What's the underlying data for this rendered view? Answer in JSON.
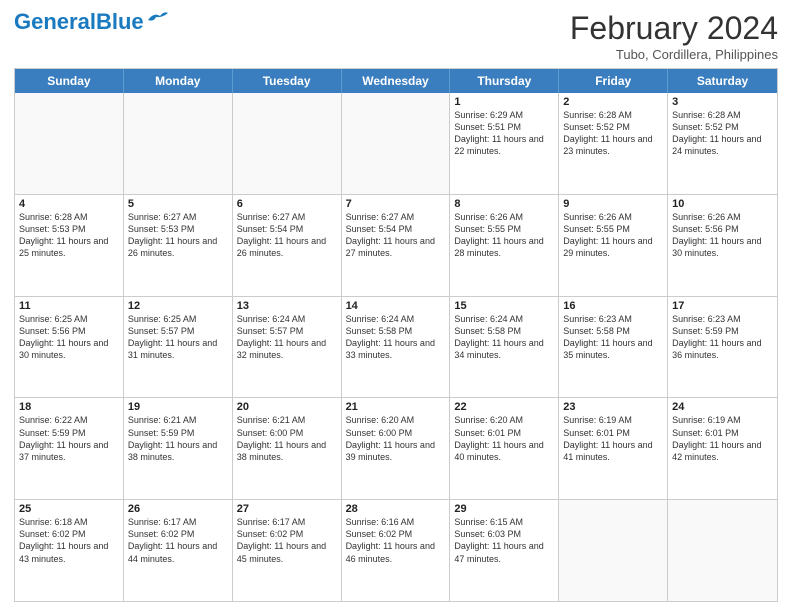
{
  "header": {
    "logo_line1": "General",
    "logo_line2": "Blue",
    "month_year": "February 2024",
    "location": "Tubo, Cordillera, Philippines"
  },
  "weekdays": [
    "Sunday",
    "Monday",
    "Tuesday",
    "Wednesday",
    "Thursday",
    "Friday",
    "Saturday"
  ],
  "weeks": [
    [
      {
        "day": "",
        "info": ""
      },
      {
        "day": "",
        "info": ""
      },
      {
        "day": "",
        "info": ""
      },
      {
        "day": "",
        "info": ""
      },
      {
        "day": "1",
        "info": "Sunrise: 6:29 AM\nSunset: 5:51 PM\nDaylight: 11 hours\nand 22 minutes."
      },
      {
        "day": "2",
        "info": "Sunrise: 6:28 AM\nSunset: 5:52 PM\nDaylight: 11 hours\nand 23 minutes."
      },
      {
        "day": "3",
        "info": "Sunrise: 6:28 AM\nSunset: 5:52 PM\nDaylight: 11 hours\nand 24 minutes."
      }
    ],
    [
      {
        "day": "4",
        "info": "Sunrise: 6:28 AM\nSunset: 5:53 PM\nDaylight: 11 hours\nand 25 minutes."
      },
      {
        "day": "5",
        "info": "Sunrise: 6:27 AM\nSunset: 5:53 PM\nDaylight: 11 hours\nand 26 minutes."
      },
      {
        "day": "6",
        "info": "Sunrise: 6:27 AM\nSunset: 5:54 PM\nDaylight: 11 hours\nand 26 minutes."
      },
      {
        "day": "7",
        "info": "Sunrise: 6:27 AM\nSunset: 5:54 PM\nDaylight: 11 hours\nand 27 minutes."
      },
      {
        "day": "8",
        "info": "Sunrise: 6:26 AM\nSunset: 5:55 PM\nDaylight: 11 hours\nand 28 minutes."
      },
      {
        "day": "9",
        "info": "Sunrise: 6:26 AM\nSunset: 5:55 PM\nDaylight: 11 hours\nand 29 minutes."
      },
      {
        "day": "10",
        "info": "Sunrise: 6:26 AM\nSunset: 5:56 PM\nDaylight: 11 hours\nand 30 minutes."
      }
    ],
    [
      {
        "day": "11",
        "info": "Sunrise: 6:25 AM\nSunset: 5:56 PM\nDaylight: 11 hours\nand 30 minutes."
      },
      {
        "day": "12",
        "info": "Sunrise: 6:25 AM\nSunset: 5:57 PM\nDaylight: 11 hours\nand 31 minutes."
      },
      {
        "day": "13",
        "info": "Sunrise: 6:24 AM\nSunset: 5:57 PM\nDaylight: 11 hours\nand 32 minutes."
      },
      {
        "day": "14",
        "info": "Sunrise: 6:24 AM\nSunset: 5:58 PM\nDaylight: 11 hours\nand 33 minutes."
      },
      {
        "day": "15",
        "info": "Sunrise: 6:24 AM\nSunset: 5:58 PM\nDaylight: 11 hours\nand 34 minutes."
      },
      {
        "day": "16",
        "info": "Sunrise: 6:23 AM\nSunset: 5:58 PM\nDaylight: 11 hours\nand 35 minutes."
      },
      {
        "day": "17",
        "info": "Sunrise: 6:23 AM\nSunset: 5:59 PM\nDaylight: 11 hours\nand 36 minutes."
      }
    ],
    [
      {
        "day": "18",
        "info": "Sunrise: 6:22 AM\nSunset: 5:59 PM\nDaylight: 11 hours\nand 37 minutes."
      },
      {
        "day": "19",
        "info": "Sunrise: 6:21 AM\nSunset: 5:59 PM\nDaylight: 11 hours\nand 38 minutes."
      },
      {
        "day": "20",
        "info": "Sunrise: 6:21 AM\nSunset: 6:00 PM\nDaylight: 11 hours\nand 38 minutes."
      },
      {
        "day": "21",
        "info": "Sunrise: 6:20 AM\nSunset: 6:00 PM\nDaylight: 11 hours\nand 39 minutes."
      },
      {
        "day": "22",
        "info": "Sunrise: 6:20 AM\nSunset: 6:01 PM\nDaylight: 11 hours\nand 40 minutes."
      },
      {
        "day": "23",
        "info": "Sunrise: 6:19 AM\nSunset: 6:01 PM\nDaylight: 11 hours\nand 41 minutes."
      },
      {
        "day": "24",
        "info": "Sunrise: 6:19 AM\nSunset: 6:01 PM\nDaylight: 11 hours\nand 42 minutes."
      }
    ],
    [
      {
        "day": "25",
        "info": "Sunrise: 6:18 AM\nSunset: 6:02 PM\nDaylight: 11 hours\nand 43 minutes."
      },
      {
        "day": "26",
        "info": "Sunrise: 6:17 AM\nSunset: 6:02 PM\nDaylight: 11 hours\nand 44 minutes."
      },
      {
        "day": "27",
        "info": "Sunrise: 6:17 AM\nSunset: 6:02 PM\nDaylight: 11 hours\nand 45 minutes."
      },
      {
        "day": "28",
        "info": "Sunrise: 6:16 AM\nSunset: 6:02 PM\nDaylight: 11 hours\nand 46 minutes."
      },
      {
        "day": "29",
        "info": "Sunrise: 6:15 AM\nSunset: 6:03 PM\nDaylight: 11 hours\nand 47 minutes."
      },
      {
        "day": "",
        "info": ""
      },
      {
        "day": "",
        "info": ""
      }
    ]
  ]
}
